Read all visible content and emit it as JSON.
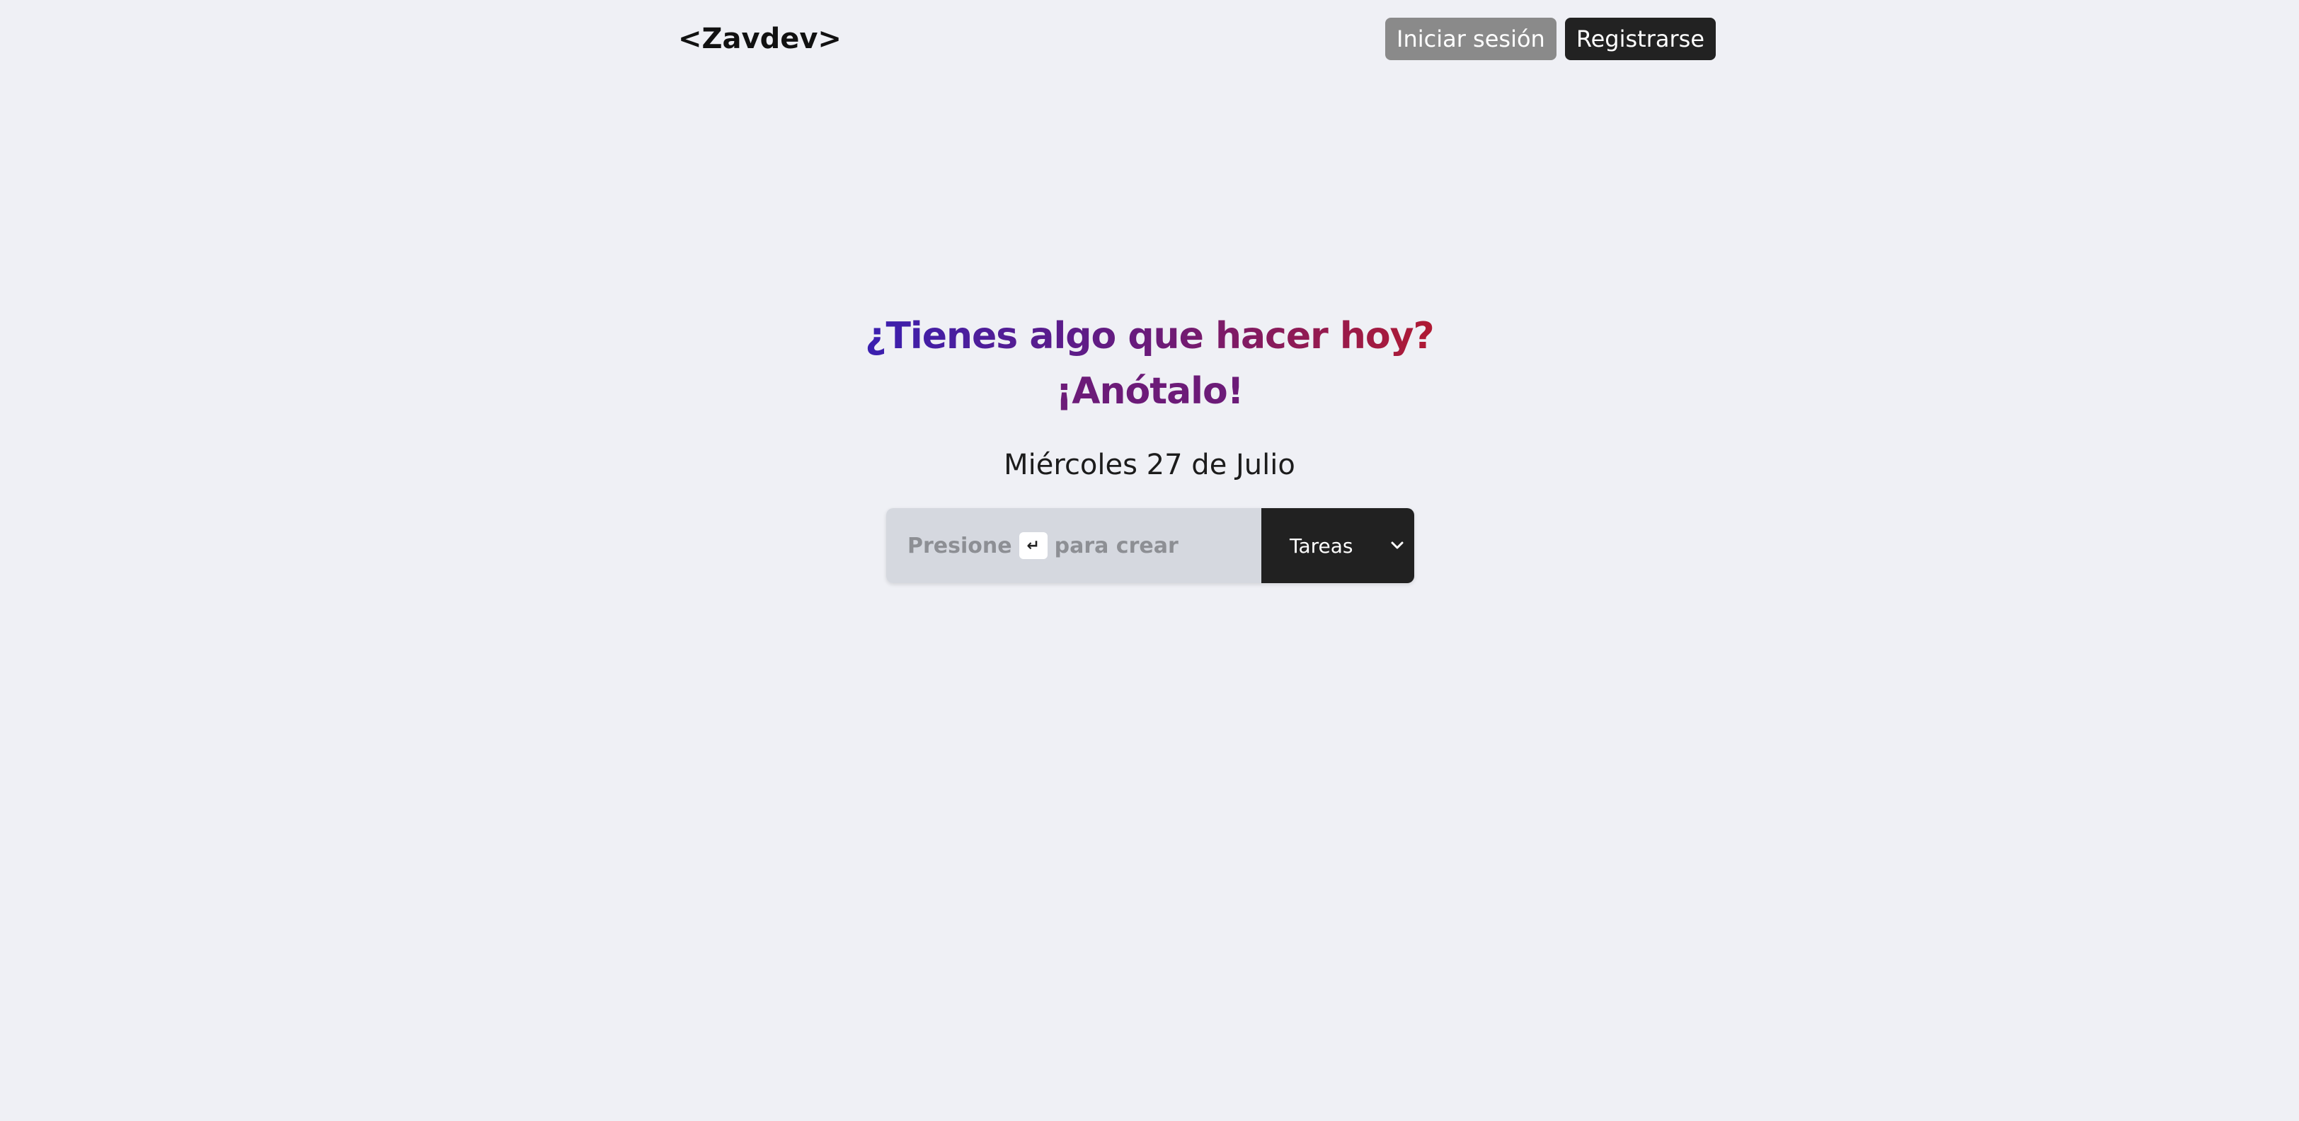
{
  "header": {
    "logo": "<Zavdev>",
    "login_label": "Iniciar sesión",
    "register_label": "Registrarse"
  },
  "hero": {
    "headline_line1": "¿Tienes algo que hacer hoy?",
    "headline_line2": "¡Anótalo!",
    "date": "Miércoles 27 de Julio"
  },
  "task_form": {
    "placeholder_before": "Presione",
    "placeholder_key": "↵",
    "placeholder_after": "para crear",
    "input_value": "",
    "selected_category": "Tareas"
  },
  "colors": {
    "background": "#eff0f5",
    "headline_start": "#3a1fb0",
    "headline_mid": "#6a1b7a",
    "headline_end": "#b01a33",
    "dark": "#212121",
    "login_button": "#8a8a8a"
  }
}
